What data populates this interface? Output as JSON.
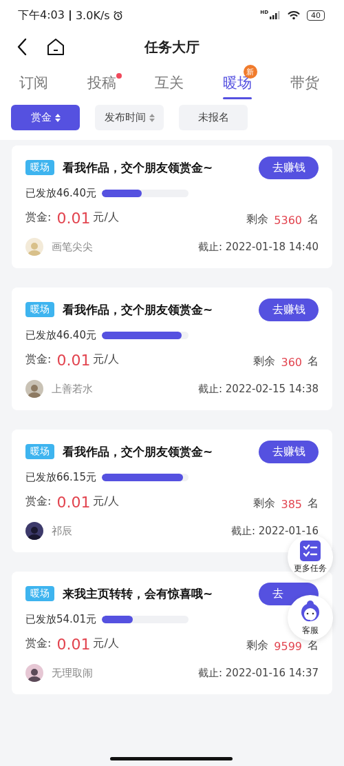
{
  "status_bar": {
    "time": "下午4:03",
    "speed": "3.0K/s",
    "network": "HD",
    "battery": "40"
  },
  "header": {
    "title": "任务大厅"
  },
  "tabs": [
    {
      "label": "订阅",
      "selected": false,
      "dot": false
    },
    {
      "label": "投稿",
      "selected": false,
      "dot": true
    },
    {
      "label": "互关",
      "selected": false,
      "dot": false
    },
    {
      "label": "暖场",
      "selected": true,
      "dot": false,
      "badge": "新"
    },
    {
      "label": "带货",
      "selected": false,
      "dot": false
    }
  ],
  "filters": [
    {
      "label": "赏金",
      "selected": true,
      "sortable": true
    },
    {
      "label": "发布时间",
      "selected": false,
      "sortable": true
    },
    {
      "label": "未报名",
      "selected": false,
      "sortable": false
    }
  ],
  "tasks": [
    {
      "tag": "暖场",
      "title": "看我作品，交个朋友领赏金~",
      "button": "去赚钱",
      "paid": "已发放46.40元",
      "level": 0.46,
      "reward_label": "赏金:",
      "reward": "0.01",
      "reward_unit": "元/人",
      "remaining_label": "剩余",
      "remaining": "5360",
      "remaining_unit": "名",
      "author": "画笔尖尖",
      "deadline": "截止: 2022-01-18 14:40"
    },
    {
      "tag": "暖场",
      "title": "看我作品，交个朋友领赏金~",
      "button": "去赚钱",
      "paid": "已发放46.40元",
      "level": 0.92,
      "reward_label": "赏金:",
      "reward": "0.01",
      "reward_unit": "元/人",
      "remaining_label": "剩余",
      "remaining": "360",
      "remaining_unit": "名",
      "author": "上善若水",
      "deadline": "截止: 2022-02-15 14:38"
    },
    {
      "tag": "暖场",
      "title": "看我作品，交个朋友领赏金~",
      "button": "去赚钱",
      "paid": "已发放66.15元",
      "level": 0.94,
      "reward_label": "赏金:",
      "reward": "0.01",
      "reward_unit": "元/人",
      "remaining_label": "剩余",
      "remaining": "385",
      "remaining_unit": "名",
      "author": "祁辰",
      "deadline": "截止: 2022-01-16"
    },
    {
      "tag": "暖场",
      "title": "来我主页转转，会有惊喜哦~",
      "button": "去",
      "paid": "已发放54.01元",
      "level": 0.36,
      "reward_label": "赏金:",
      "reward": "0.01",
      "reward_unit": "元/人",
      "remaining_label": "剩余",
      "remaining": "9599",
      "remaining_unit": "名",
      "author": "无理取闹",
      "deadline": "截止: 2022-01-16 14:37"
    }
  ],
  "floating": [
    {
      "kind": "tasks",
      "label": "更多任务"
    },
    {
      "kind": "service",
      "label": "客服"
    }
  ]
}
